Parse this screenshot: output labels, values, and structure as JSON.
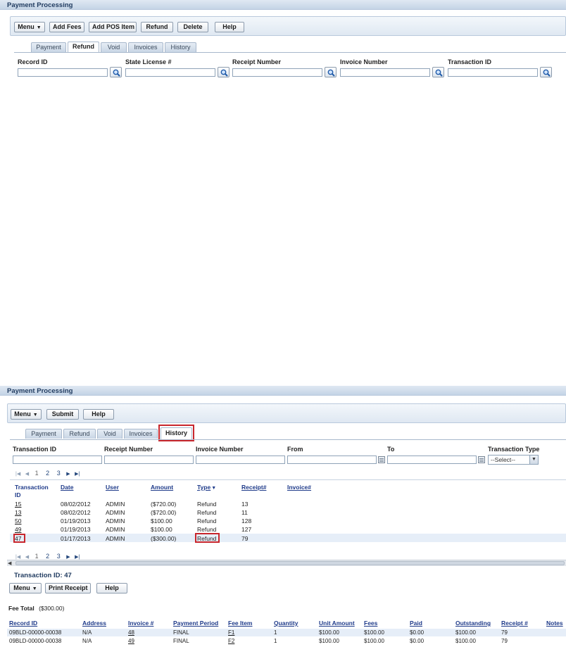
{
  "top": {
    "title": "Payment Processing",
    "toolbar": [
      "Menu",
      "Add Fees",
      "Add POS Item",
      "Refund",
      "Delete",
      "Help"
    ],
    "tabs": [
      "Payment",
      "Refund",
      "Void",
      "Invoices",
      "History"
    ],
    "active_tab": "Refund",
    "fields": [
      "Record ID",
      "State License #",
      "Receipt Number",
      "Invoice Number",
      "Transaction ID"
    ]
  },
  "bottom": {
    "title": "Payment Processing",
    "toolbar": [
      "Menu",
      "Submit",
      "Help"
    ],
    "tabs": [
      "Payment",
      "Refund",
      "Void",
      "Invoices",
      "History"
    ],
    "active_tab": "History",
    "filters": {
      "labels": [
        "Transaction ID",
        "Receipt Number",
        "Invoice Number",
        "From",
        "To",
        "Transaction Type"
      ],
      "select_value": "--Select--"
    },
    "pager": [
      "1",
      "2",
      "3"
    ],
    "columns": [
      "Transaction ID",
      "Date",
      "User",
      "Amount",
      "Type",
      "Receipt#",
      "Invoice#"
    ],
    "rows": [
      {
        "id": "15",
        "date": "08/02/2012",
        "user": "ADMIN",
        "amount": "($720.00)",
        "type": "Refund",
        "receipt": "13"
      },
      {
        "id": "13",
        "date": "08/02/2012",
        "user": "ADMIN",
        "amount": "($720.00)",
        "type": "Refund",
        "receipt": "11"
      },
      {
        "id": "50",
        "date": "01/19/2013",
        "user": "ADMIN",
        "amount": "$100.00",
        "type": "Refund",
        "receipt": "128"
      },
      {
        "id": "49",
        "date": "01/19/2013",
        "user": "ADMIN",
        "amount": "$100.00",
        "type": "Refund",
        "receipt": "127"
      },
      {
        "id": "47",
        "date": "01/17/2013",
        "user": "ADMIN",
        "amount": "($300.00)",
        "type": "Refund",
        "receipt": "79"
      }
    ],
    "detail": {
      "title": "Transaction ID: 47",
      "toolbar": [
        "Menu",
        "Print Receipt",
        "Help"
      ],
      "fee_total_label": "Fee Total",
      "fee_total_value": "($300.00)",
      "fee_columns": [
        "Record ID",
        "Address",
        "Invoice #",
        "Payment Period",
        "Fee Item",
        "Quantity",
        "Unit Amount",
        "Fees",
        "Paid",
        "Outstanding",
        "Receipt #",
        "Notes"
      ],
      "fee_rows": [
        [
          "09BLD-00000-00038",
          "N/A",
          "48",
          "FINAL",
          "F1",
          "1",
          "$100.00",
          "$100.00",
          "$0.00",
          "$100.00",
          "79",
          ""
        ],
        [
          "09BLD-00000-00038",
          "N/A",
          "49",
          "FINAL",
          "F2",
          "1",
          "$100.00",
          "$100.00",
          "$0.00",
          "$100.00",
          "79",
          ""
        ]
      ]
    }
  }
}
